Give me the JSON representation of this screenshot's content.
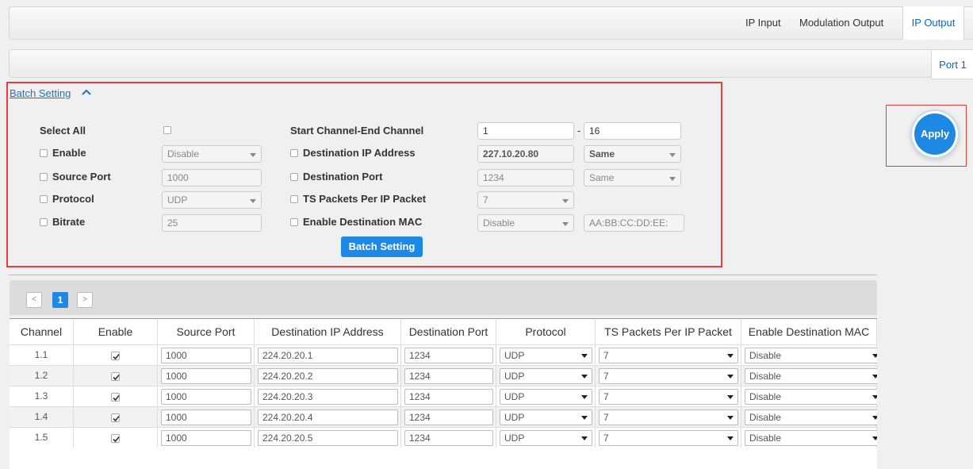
{
  "tabs": {
    "ip_input": "IP Input",
    "modulation_output": "Modulation Output",
    "ip_output": "IP Output"
  },
  "port_tab": "Port 1",
  "batch": {
    "toggle_label": "Batch Setting",
    "select_all": "Select All",
    "enable": {
      "label": "Enable",
      "value": "Disable"
    },
    "source_port": {
      "label": "Source Port",
      "value": "1000"
    },
    "protocol": {
      "label": "Protocol",
      "value": "UDP"
    },
    "bitrate": {
      "label": "Bitrate",
      "value": "25"
    },
    "channel_range": {
      "label": "Start Channel-End Channel",
      "start": "1",
      "sep": "-",
      "end": "16"
    },
    "dest_ip": {
      "label": "Destination IP Address",
      "value": "227.10.20.80",
      "mode": "Same"
    },
    "dest_port": {
      "label": "Destination Port",
      "value": "1234",
      "mode": "Same"
    },
    "ts_packets": {
      "label": "TS Packets Per IP Packet",
      "value": "7"
    },
    "dest_mac": {
      "label": "Enable Destination MAC",
      "value": "Disable",
      "mac_placeholder": "AA:BB:CC:DD:EE:"
    },
    "submit": "Batch Setting"
  },
  "apply": "Apply",
  "pager": {
    "prev": "<",
    "current": "1",
    "next": ">"
  },
  "table": {
    "headers": [
      "Channel",
      "Enable",
      "Source Port",
      "Destination IP Address",
      "Destination Port",
      "Protocol",
      "TS Packets Per IP Packet",
      "Enable Destination MAC"
    ],
    "rows": [
      {
        "channel": "1.1",
        "enabled": true,
        "source_port": "1000",
        "dest_ip": "224.20.20.1",
        "dest_port": "1234",
        "protocol": "UDP",
        "ts": "7",
        "mac": "Disable"
      },
      {
        "channel": "1.2",
        "enabled": true,
        "source_port": "1000",
        "dest_ip": "224.20.20.2",
        "dest_port": "1234",
        "protocol": "UDP",
        "ts": "7",
        "mac": "Disable"
      },
      {
        "channel": "1.3",
        "enabled": true,
        "source_port": "1000",
        "dest_ip": "224.20.20.3",
        "dest_port": "1234",
        "protocol": "UDP",
        "ts": "7",
        "mac": "Disable"
      },
      {
        "channel": "1.4",
        "enabled": true,
        "source_port": "1000",
        "dest_ip": "224.20.20.4",
        "dest_port": "1234",
        "protocol": "UDP",
        "ts": "7",
        "mac": "Disable"
      },
      {
        "channel": "1.5",
        "enabled": true,
        "source_port": "1000",
        "dest_ip": "224.20.20.5",
        "dest_port": "1234",
        "protocol": "UDP",
        "ts": "7",
        "mac": "Disable"
      }
    ]
  },
  "colors": {
    "accent": "#1e88e5",
    "highlight": "#e53e3e",
    "link": "#1a73c8"
  }
}
